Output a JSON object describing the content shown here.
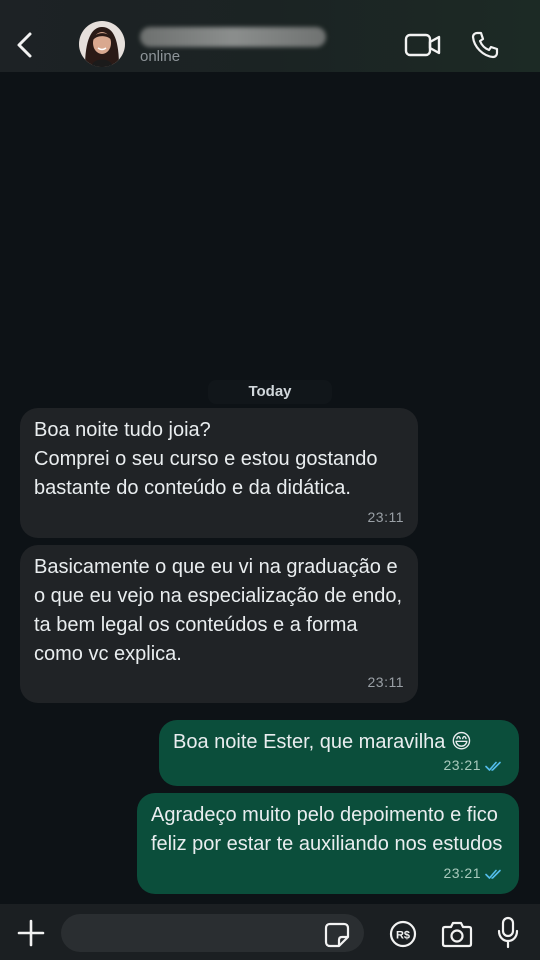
{
  "header": {
    "status": "online",
    "back_icon": "chevron-left-icon",
    "video_icon": "video-camera-icon",
    "call_icon": "phone-icon"
  },
  "chat": {
    "day_label": "Today",
    "messages": [
      {
        "direction": "incoming",
        "text": "Boa noite tudo joia?\nComprei o seu curso e estou gostando bastante do conteúdo e da didática.",
        "time": "23:11"
      },
      {
        "direction": "incoming",
        "text": "Basicamente o que eu vi na graduação e o que eu vejo na especialização de endo, ta bem legal os conteúdos e a forma como vc explica.",
        "time": "23:11"
      },
      {
        "direction": "outgoing",
        "text": "Boa noite Ester, que maravilha 😄",
        "time": "23:21",
        "read": true
      },
      {
        "direction": "outgoing",
        "text": "Agradeço muito pelo depoimento e fico feliz por estar te auxiliando nos estudos",
        "time": "23:21",
        "read": true
      }
    ]
  },
  "composer": {
    "input_value": "",
    "icons": [
      "plus-icon",
      "sticker-icon",
      "pix-icon",
      "camera-icon",
      "microphone-icon"
    ],
    "pix_label": "R$"
  },
  "colors": {
    "incoming_bubble": "#202326",
    "outgoing_bubble": "#0b4e3b",
    "read_ticks": "#53bdeb",
    "background": "#0d1216"
  }
}
